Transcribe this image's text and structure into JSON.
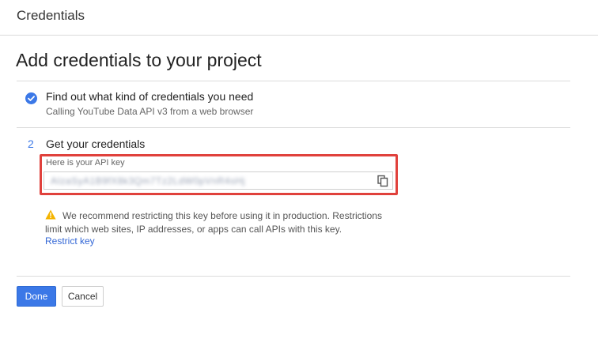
{
  "header": {
    "title": "Credentials"
  },
  "page": {
    "title": "Add credentials to your project"
  },
  "step1": {
    "title": "Find out what kind of credentials you need",
    "subtitle": "Calling YouTube Data API v3 from a web browser"
  },
  "step2": {
    "number": "2",
    "title": "Get your credentials",
    "api_key_label": "Here is your API key",
    "api_key_value": "AIzaSyA1B9fX8k3Qm7Tz2LdW0pVnR4sHj"
  },
  "warning": {
    "text": "We recommend restricting this key before using it in production. Restrictions limit which web sites, IP addresses, or apps can call APIs with this key.",
    "link": "Restrict key"
  },
  "actions": {
    "done": "Done",
    "cancel": "Cancel"
  },
  "colors": {
    "accent": "#3b78e7",
    "highlight": "#e0413c",
    "warning": "#f4b400"
  },
  "icons": [
    "check-circle-icon",
    "copy-icon",
    "warning-icon"
  ]
}
